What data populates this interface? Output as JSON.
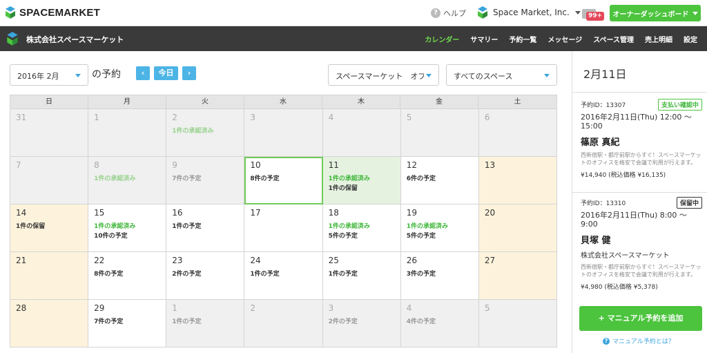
{
  "topbar": {
    "brand": "SPACEMARKET",
    "help_label": "ヘルプ",
    "account_name": "Space Market, Inc.",
    "notification_badge": "99+",
    "owner_dashboard_label": "オーナーダッシュボード"
  },
  "navbar": {
    "company": "株式会社スペースマーケット",
    "items": [
      {
        "label": "カレンダー",
        "active": true
      },
      {
        "label": "サマリー"
      },
      {
        "label": "予約一覧"
      },
      {
        "label": "メッセージ"
      },
      {
        "label": "スペース管理"
      },
      {
        "label": "売上明細"
      },
      {
        "label": "設定"
      }
    ]
  },
  "controls": {
    "month": "2016年 2月",
    "suffix": "の予約",
    "prev_icon": "chevron-left-icon",
    "today_label": "今日",
    "next_icon": "chevron-right-icon",
    "space_select": "スペースマーケット　オフ",
    "space_filter": "すべてのスペース"
  },
  "calendar": {
    "weekdays": [
      "日",
      "月",
      "火",
      "水",
      "木",
      "金",
      "土"
    ],
    "weeks": [
      [
        {
          "day": "31",
          "other": true,
          "events": []
        },
        {
          "day": "1",
          "other": true,
          "events": []
        },
        {
          "day": "2",
          "other": true,
          "events": [
            {
              "text": "1件の承認済み",
              "color": "green"
            }
          ]
        },
        {
          "day": "3",
          "other": true,
          "events": []
        },
        {
          "day": "4",
          "other": true,
          "events": []
        },
        {
          "day": "5",
          "other": true,
          "events": []
        },
        {
          "day": "6",
          "other": true,
          "events": []
        }
      ],
      [
        {
          "day": "7",
          "other": true,
          "events": []
        },
        {
          "day": "8",
          "other": true,
          "events": [
            {
              "text": "1件の承認済み",
              "color": "green"
            }
          ]
        },
        {
          "day": "9",
          "other": true,
          "events": [
            {
              "text": "7件の予定",
              "color": "gray"
            }
          ]
        },
        {
          "day": "10",
          "today": true,
          "events": [
            {
              "text": "8件の予定",
              "color": "dark"
            }
          ]
        },
        {
          "day": "11",
          "selected": true,
          "events": [
            {
              "text": "1件の承認済み",
              "color": "green"
            },
            {
              "text": "1件の保留",
              "color": "dark"
            }
          ]
        },
        {
          "day": "12",
          "events": [
            {
              "text": "6件の予定",
              "color": "dark"
            }
          ]
        },
        {
          "day": "13",
          "weekend": true,
          "events": []
        }
      ],
      [
        {
          "day": "14",
          "weekend": true,
          "events": [
            {
              "text": "1件の保留",
              "color": "dark"
            }
          ]
        },
        {
          "day": "15",
          "events": [
            {
              "text": "1件の承認済み",
              "color": "green"
            },
            {
              "text": "10件の予定",
              "color": "dark"
            }
          ]
        },
        {
          "day": "16",
          "events": [
            {
              "text": "1件の予定",
              "color": "dark"
            }
          ]
        },
        {
          "day": "17",
          "events": []
        },
        {
          "day": "18",
          "events": [
            {
              "text": "1件の承認済み",
              "color": "green"
            },
            {
              "text": "5件の予定",
              "color": "dark"
            }
          ]
        },
        {
          "day": "19",
          "events": [
            {
              "text": "1件の承認済み",
              "color": "green"
            },
            {
              "text": "5件の予定",
              "color": "dark"
            }
          ]
        },
        {
          "day": "20",
          "weekend": true,
          "events": []
        }
      ],
      [
        {
          "day": "21",
          "weekend": true,
          "events": []
        },
        {
          "day": "22",
          "events": [
            {
              "text": "8件の予定",
              "color": "dark"
            }
          ]
        },
        {
          "day": "23",
          "events": [
            {
              "text": "2件の予定",
              "color": "dark"
            }
          ]
        },
        {
          "day": "24",
          "events": [
            {
              "text": "1件の予定",
              "color": "dark"
            }
          ]
        },
        {
          "day": "25",
          "events": [
            {
              "text": "1件の予定",
              "color": "dark"
            }
          ]
        },
        {
          "day": "26",
          "events": [
            {
              "text": "3件の予定",
              "color": "dark"
            }
          ]
        },
        {
          "day": "27",
          "weekend": true,
          "events": []
        }
      ],
      [
        {
          "day": "28",
          "weekend": true,
          "events": []
        },
        {
          "day": "29",
          "events": [
            {
              "text": "7件の予定",
              "color": "dark"
            }
          ]
        },
        {
          "day": "1",
          "other": true,
          "events": [
            {
              "text": "1件の予定",
              "color": "gray"
            }
          ]
        },
        {
          "day": "2",
          "other": true,
          "events": []
        },
        {
          "day": "3",
          "other": true,
          "events": [
            {
              "text": "2件の予定",
              "color": "gray"
            }
          ]
        },
        {
          "day": "4",
          "other": true,
          "events": [
            {
              "text": "4件の予定",
              "color": "gray"
            }
          ]
        },
        {
          "day": "5",
          "other": true,
          "events": []
        }
      ]
    ]
  },
  "side": {
    "date": "2月11日",
    "reservations": [
      {
        "id": "予約ID：13307",
        "badge": "支払い確認中",
        "badge_style": "green",
        "time": "2016年2月11日(Thu) 12:00 〜 15:00",
        "name": "篠原 真紀",
        "company": "",
        "desc": "西新宿駅・都庁前駅からすぐ！スペースマーケットのオフィスを格安で会議で利用が行えます。",
        "price": "¥14,940 (税込価格 ¥16,135)"
      },
      {
        "id": "予約ID：13310",
        "badge": "保留中",
        "badge_style": "dark",
        "time": "2016年2月11日(Thu) 8:00 〜 9:00",
        "name": "貝塚 健",
        "company": "株式会社スペースマーケット",
        "desc": "西新宿駅・都庁前駅からすぐ！スペースマーケットのオフィスを格安で会議で利用が行えます。",
        "price": "¥4,980 (税込価格 ¥5,378)"
      }
    ],
    "add_button": "+ マニュアル予約を追加",
    "help_link": "マニュアル予約とは？"
  },
  "colors": {
    "accent_green": "#4cc43e",
    "accent_blue": "#4db4e6",
    "nav_bg": "#3a3a3a",
    "weekend_bg": "#fdf3dc"
  }
}
